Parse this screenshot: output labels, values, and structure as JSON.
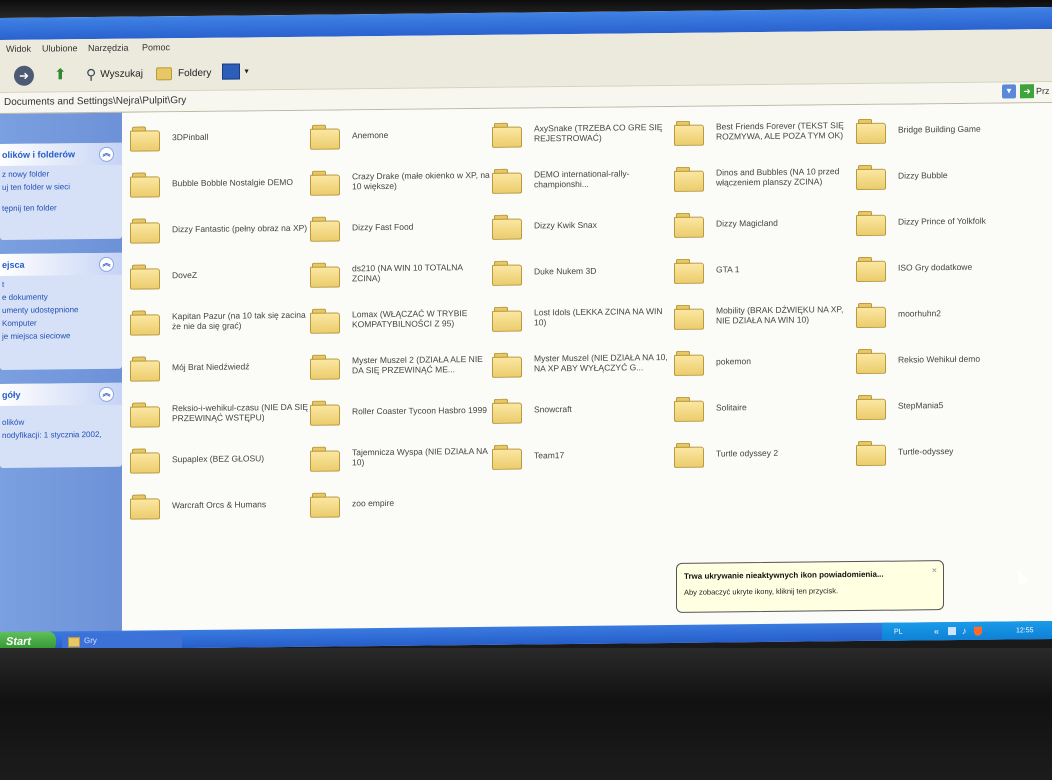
{
  "menu": [
    "Widok",
    "Ulubione",
    "Narzędzia",
    "Pomoc"
  ],
  "toolbar": {
    "search": "Wyszukaj",
    "folders": "Foldery"
  },
  "address": {
    "path": "Documents and Settings\\Nejra\\Pulpit\\Gry",
    "go": "Prz"
  },
  "panels": [
    {
      "title": "olików i folderów",
      "items": [
        "z nowy folder",
        "uj ten folder w sieci",
        "tępnij ten folder"
      ]
    },
    {
      "title": "ejsca",
      "items": [
        "t",
        "e dokumenty",
        "umenty udostępnione",
        "Komputer",
        "je miejsca sieciowe"
      ]
    },
    {
      "title": "góły",
      "items": [
        "olików",
        "nodyfikacji: 1 stycznia 2002,"
      ]
    }
  ],
  "folders": [
    "3DPinball",
    "Anemone",
    "AxySnake (TRZEBA CO GRE SIĘ REJESTROWAĆ)",
    "Best Friends Forever (TEKST SIĘ ROZMYWA, ALE POZA TYM OK)",
    "Bridge Building Game",
    "Bubble Bobble Nostalgie DEMO",
    "Crazy Drake (małe okienko w XP, na 10 większe)",
    "DEMO international-rally-championshi...",
    "Dinos and Bubbles (NA 10 przed włączeniem planszy ZCINA)",
    "Dizzy Bubble",
    "Dizzy Fantastic (pełny obraz na XP)",
    "Dizzy Fast Food",
    "Dizzy Kwik Snax",
    "Dizzy Magicland",
    "Dizzy Prince of Yolkfolk",
    "DoveZ",
    "ds210 (NA WIN 10 TOTALNA ZCINA)",
    "Duke Nukem 3D",
    "GTA 1",
    "ISO Gry dodatkowe",
    "Kapitan Pazur (na 10 tak się zacina że nie da się grać)",
    "Lomax (WŁĄCZAĆ W TRYBIE KOMPATYBILNOŚCI Z 95)",
    "Lost Idols (LEKKA ZCINA NA WIN 10)",
    "Mobility (BRAK DŹWIĘKU NA XP, NIE DZIAŁA NA WIN 10)",
    "moorhuhn2",
    "Mój Brat Niedźwiedź",
    "Myster Muszel 2 (DZIAŁA ALE NIE DA SIĘ PRZEWINĄĆ ME...",
    "Myster Muszel (NIE DZIAŁA NA 10, NA XP ABY WYŁĄCZYĆ G...",
    "pokemon",
    "Reksio Wehikuł demo",
    "Reksio-i-wehikul-czasu (NIE DA SIĘ PRZEWINĄĆ WSTĘPU)",
    "Roller Coaster Tycoon Hasbro 1999",
    "Snowcraft",
    "Solitaire",
    "StepMania5",
    "Supaplex (BEZ GŁOSU)",
    "Tajemnicza Wyspa (NIE DZIAŁA NA 10)",
    "Team17",
    "Turtle odyssey 2",
    "Turtle-odyssey",
    "Warcraft Orcs & Humans",
    "zoo empire"
  ],
  "taskbar": {
    "start": "Start",
    "window": "Gry",
    "lang": "PL",
    "clock": "12:55"
  },
  "balloon": {
    "title": "Trwa ukrywanie nieaktywnych ikon powiadomienia...",
    "message": "Aby zobaczyć ukryte ikony, kliknij ten przycisk.",
    "close": "×"
  }
}
